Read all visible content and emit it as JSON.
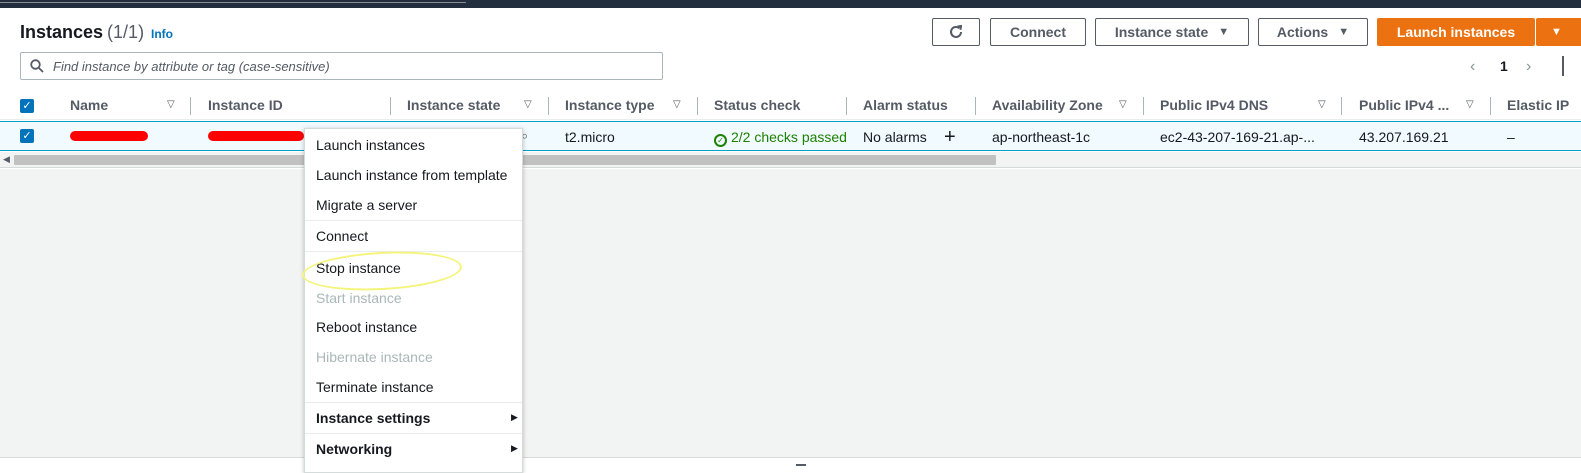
{
  "header": {
    "title": "Instances",
    "count": "(1/1)",
    "info": "Info",
    "buttons": {
      "connect": "Connect",
      "instance_state": "Instance state",
      "actions": "Actions",
      "launch": "Launch instances"
    },
    "icons": {
      "refresh": "refresh-icon",
      "caret": "caret-down-icon"
    }
  },
  "search": {
    "placeholder": "Find instance by attribute or tag (case-sensitive)"
  },
  "pagination": {
    "prev": "‹",
    "page": "1",
    "next": "›"
  },
  "table": {
    "columns": [
      "Name",
      "Instance ID",
      "Instance state",
      "Instance type",
      "Status check",
      "Alarm status",
      "Availability Zone",
      "Public IPv4 DNS",
      "Public IPv4 ...",
      "Elastic IP"
    ],
    "row": {
      "instance_type": "t2.micro",
      "status_check": "2/2 checks passed",
      "alarm_status": "No alarms",
      "availability_zone": "ap-northeast-1c",
      "public_dns": "ec2-43-207-169-21.ap-...",
      "public_ip": "43.207.169.21",
      "elastic_ip": "–"
    }
  },
  "context_menu": {
    "items": [
      {
        "label": "Launch instances",
        "disabled": false
      },
      {
        "label": "Launch instance from template",
        "disabled": false
      },
      {
        "label": "Migrate a server",
        "disabled": false
      },
      {
        "label": "Connect",
        "disabled": false
      },
      {
        "label": "Stop instance",
        "disabled": false
      },
      {
        "label": "Start instance",
        "disabled": true
      },
      {
        "label": "Reboot instance",
        "disabled": false
      },
      {
        "label": "Hibernate instance",
        "disabled": true
      },
      {
        "label": "Terminate instance",
        "disabled": false
      },
      {
        "label": "Instance settings",
        "submenu": true
      },
      {
        "label": "Networking",
        "submenu": true
      }
    ]
  },
  "colors": {
    "accent": "#ec7211",
    "link": "#0073bb",
    "selected_row": "#f1faff",
    "success": "#1d8102",
    "redaction": "#ff0000",
    "highlight": "#f4f47a"
  }
}
